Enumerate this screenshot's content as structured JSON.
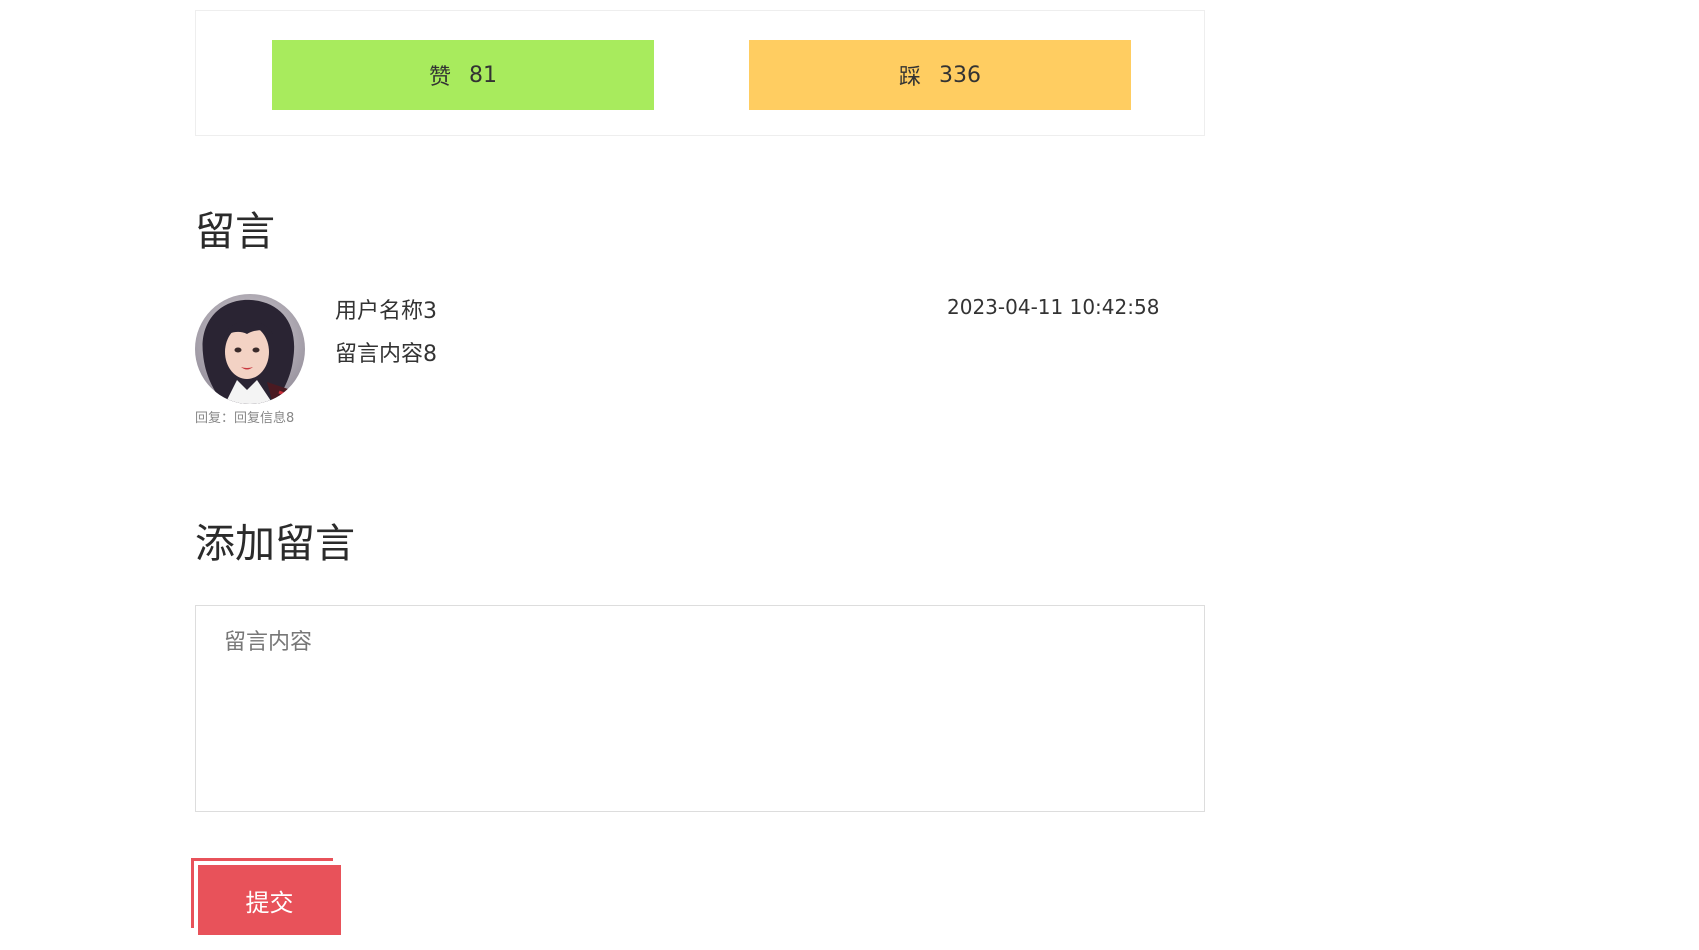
{
  "votes": {
    "like_label": "赞",
    "like_count": "81",
    "dislike_label": "踩",
    "dislike_count": "336",
    "like_color": "#a8eb5d",
    "dislike_color": "#ffcd61"
  },
  "comments_section": {
    "title": "留言",
    "items": [
      {
        "user": "用户名称3",
        "content": "留言内容8",
        "time": "2023-04-11 10:42:58",
        "reply": "回复：回复信息8",
        "avatar_icon": "user-avatar-photo"
      }
    ]
  },
  "add_comment": {
    "title": "添加留言",
    "placeholder": "留言内容",
    "value": "",
    "submit_label": "提交",
    "accent_color": "#e8525a"
  }
}
